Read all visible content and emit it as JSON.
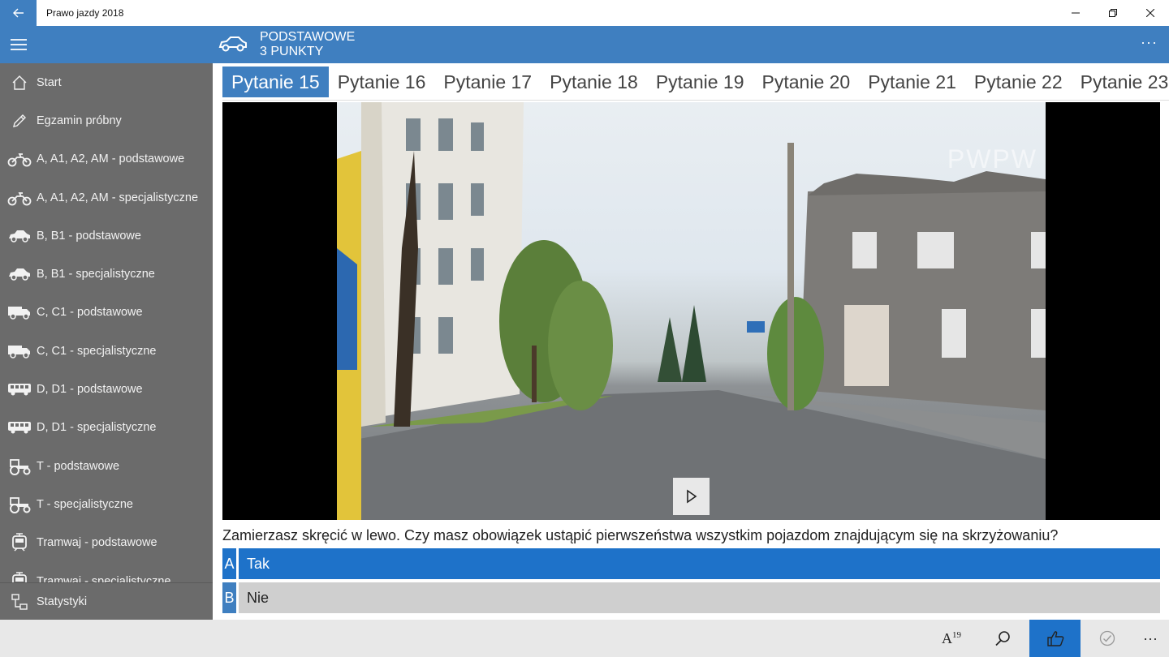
{
  "window": {
    "title": "Prawo jazdy 2018"
  },
  "header": {
    "line1": "PODSTAWOWE",
    "line2": "3 PUNKTY",
    "more": "···"
  },
  "sidebar": {
    "items": [
      {
        "label": "Start",
        "icon": "home-icon"
      },
      {
        "label": "Egzamin próbny",
        "icon": "pencil-icon"
      },
      {
        "label": "A, A1, A2, AM - podstawowe",
        "icon": "motorcycle-icon"
      },
      {
        "label": "A, A1, A2, AM - specjalistyczne",
        "icon": "motorcycle-icon"
      },
      {
        "label": "B, B1 - podstawowe",
        "icon": "car-icon"
      },
      {
        "label": "B, B1 - specjalistyczne",
        "icon": "car-icon"
      },
      {
        "label": "C, C1 - podstawowe",
        "icon": "truck-icon"
      },
      {
        "label": "C, C1 - specjalistyczne",
        "icon": "truck-icon"
      },
      {
        "label": "D, D1 - podstawowe",
        "icon": "bus-icon"
      },
      {
        "label": "D, D1 - specjalistyczne",
        "icon": "bus-icon"
      },
      {
        "label": "T - podstawowe",
        "icon": "tractor-icon"
      },
      {
        "label": "T - specjalistyczne",
        "icon": "tractor-icon"
      },
      {
        "label": "Tramwaj - podstawowe",
        "icon": "tram-icon"
      },
      {
        "label": "Tramwaj - specjalistyczne",
        "icon": "tram-icon"
      }
    ],
    "bottom": {
      "label": "Statystyki",
      "icon": "statistics-icon"
    }
  },
  "tabs": [
    "Pytanie  15",
    "Pytanie 16",
    "Pytanie 17",
    "Pytanie 18",
    "Pytanie 19",
    "Pytanie 20",
    "Pytanie 21",
    "Pytanie 22",
    "Pytanie 23"
  ],
  "active_tab": 0,
  "question": {
    "text": "Zamierzasz skręcić w lewo. Czy masz obowiązek ustąpić pierwszeństwa wszystkim pojazdom znajdującym się na skrzyżowaniu?"
  },
  "answers": [
    {
      "letter": "A",
      "text": "Tak",
      "selected": true
    },
    {
      "letter": "B",
      "text": "Nie",
      "selected": false
    }
  ],
  "video": {
    "watermark": "PWPW"
  },
  "cmdbar": {
    "font_label": "A",
    "font_size": "19",
    "more": "···"
  },
  "colors": {
    "accent": "#3f7fc0",
    "selected": "#1e72c9",
    "sidebar": "#6b6b6b"
  }
}
